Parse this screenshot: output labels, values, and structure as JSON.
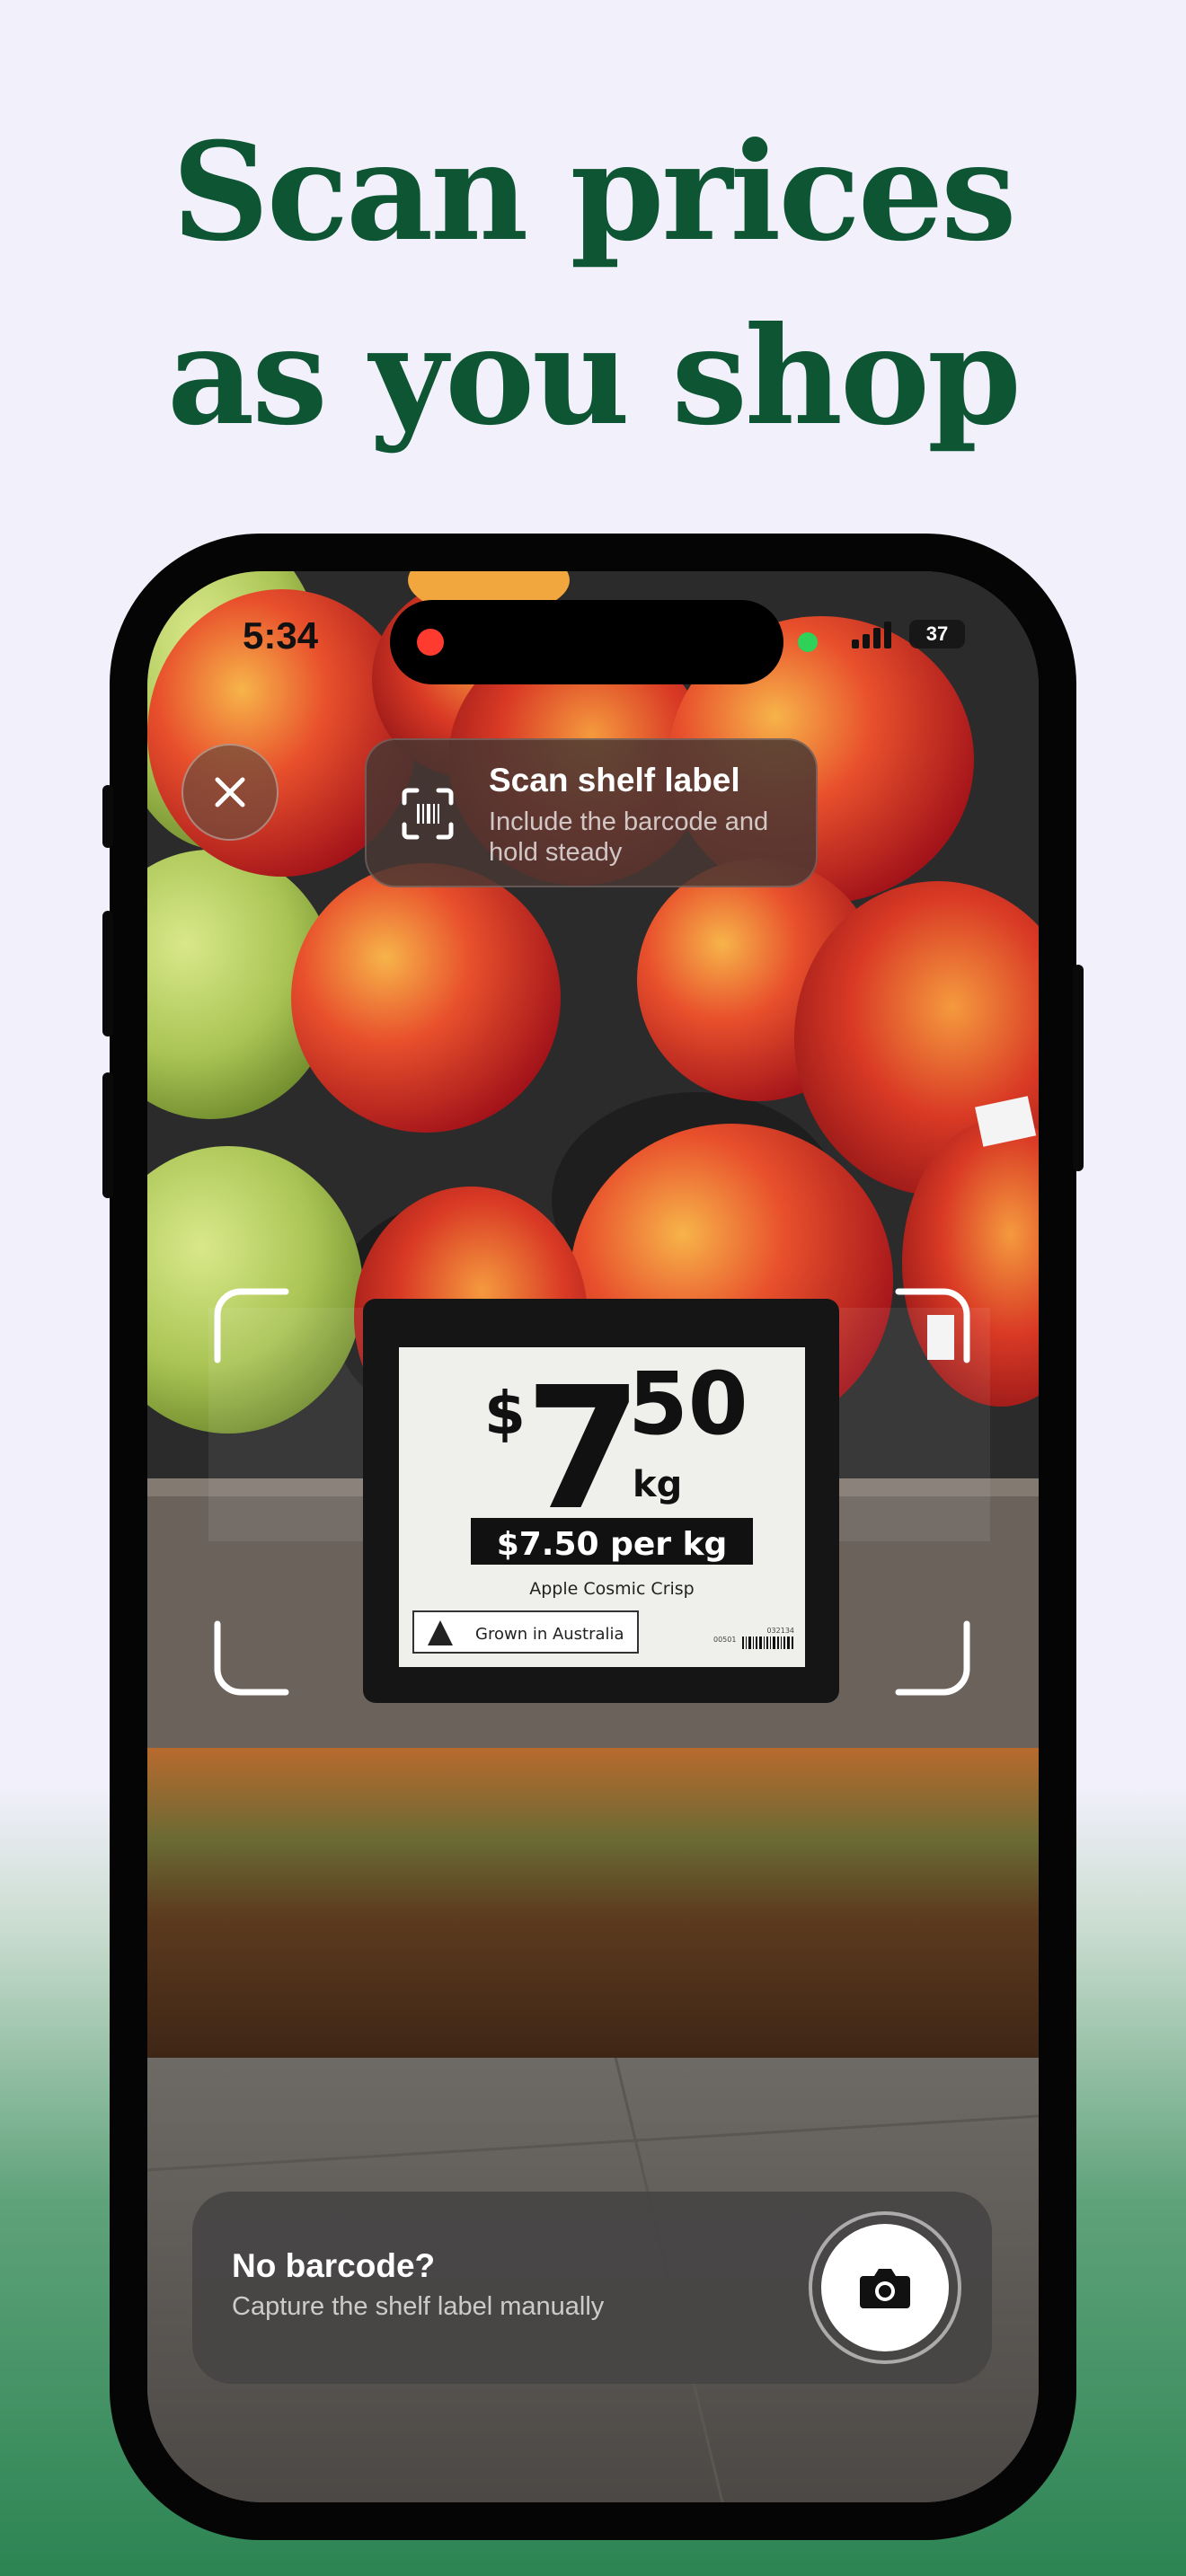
{
  "headline": {
    "line1": "Scan prices",
    "line2": "as you shop"
  },
  "status_bar": {
    "time": "5:34",
    "battery": "37"
  },
  "scan_hint": {
    "title": "Scan shelf label",
    "subtitle": "Include the barcode and hold steady",
    "icon": "barcode-scan-icon"
  },
  "close_icon": "close-icon",
  "shelf_label": {
    "currency": "$",
    "dollars": "7",
    "cents": "50",
    "unit": "kg",
    "unit_price": "$7.50 per kg",
    "product": "Apple Cosmic Crisp",
    "origin": "Grown in Australia",
    "code_left": "00501",
    "code_right": "032134"
  },
  "manual_capture": {
    "title": "No barcode?",
    "subtitle": "Capture the shelf label manually",
    "icon": "camera-icon"
  },
  "colors": {
    "headline": "#0e5534",
    "background": "#f1f0fb",
    "gradient_bottom": "#2c8453"
  }
}
